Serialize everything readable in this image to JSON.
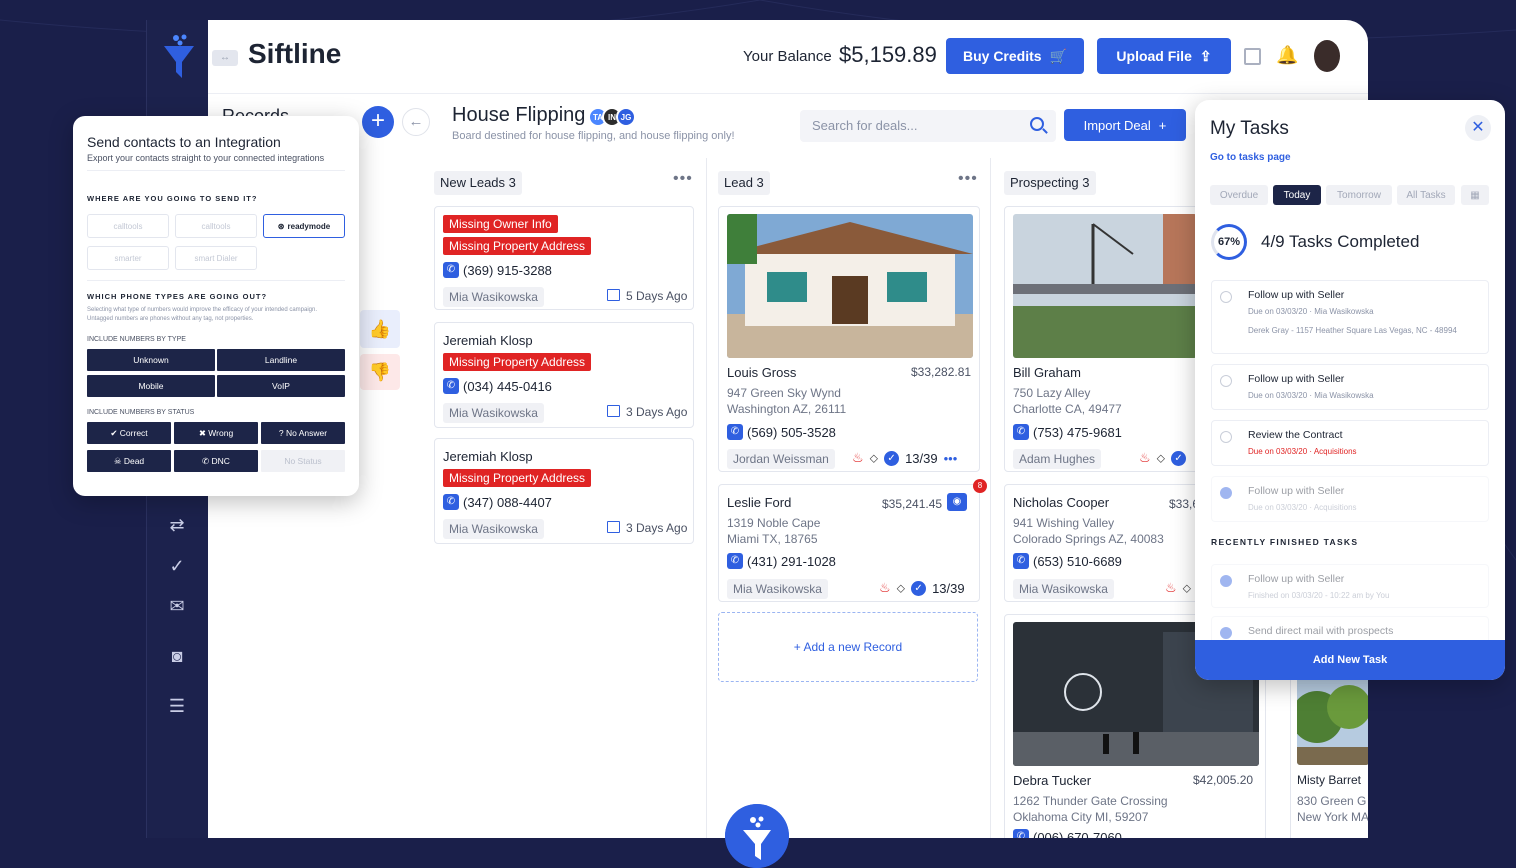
{
  "app": {
    "brand": "Siftline",
    "balance_label": "Your Balance",
    "balance_value": "$5,159.89",
    "buy_credits": "Buy Credits",
    "upload_file": "Upload File"
  },
  "board": {
    "title": "House Flipping",
    "subtitle": "Board destined for house flipping, and house flipping only!",
    "search_placeholder": "Search for deals...",
    "import_deal": "Import Deal",
    "peeking_header": "Records",
    "tags": [
      "TA",
      "IN",
      "JG"
    ]
  },
  "columns": [
    {
      "title": "New Leads",
      "count": "3"
    },
    {
      "title": "Lead",
      "count": "3"
    },
    {
      "title": "Prospecting",
      "count": "3"
    }
  ],
  "new_leads": [
    {
      "flags": [
        "Missing Owner Info",
        "Missing Property Address"
      ],
      "phone": "(369) 915-3288",
      "owner": "Mia Wasikowska",
      "ago": "5 Days Ago"
    },
    {
      "name": "Jeremiah Klosp",
      "flags": [
        "Missing Property Address"
      ],
      "phone": "(034) 445-0416",
      "owner": "Mia Wasikowska",
      "ago": "3 Days Ago"
    },
    {
      "name": "Jeremiah Klosp",
      "flags": [
        "Missing Property Address"
      ],
      "phone": "(347) 088-4407",
      "owner": "Mia Wasikowska",
      "ago": "3 Days Ago"
    }
  ],
  "lead": [
    {
      "name": "Louis Gross",
      "amount": "$33,282.81",
      "addr1": "947 Green Sky Wynd",
      "addr2": "Washington AZ, 26111",
      "phone": "(569) 505-3528",
      "owner": "Jordan Weissman",
      "progress": "13/39"
    },
    {
      "name": "Leslie Ford",
      "amount": "$35,241.45",
      "addr1": "1319 Noble Cape",
      "addr2": "Miami TX, 18765",
      "phone": "(431) 291-1028",
      "owner": "Mia Wasikowska",
      "progress": "13/39",
      "badge": "8"
    }
  ],
  "add_record": "+ Add a new Record",
  "prospecting": [
    {
      "name": "Bill Graham",
      "addr1": "750 Lazy Alley",
      "addr2": "Charlotte CA, 49477",
      "phone": "(753) 475-9681",
      "owner": "Adam Hughes"
    },
    {
      "name": "Nicholas Cooper",
      "amount": "$33,6",
      "addr1": "941 Wishing Valley",
      "addr2": "Colorado Springs AZ, 40083",
      "phone": "(653) 510-6689",
      "owner": "Mia Wasikowska"
    },
    {
      "name": "Debra Tucker",
      "amount": "$42,005.20",
      "addr1": "1262 Thunder Gate Crossing",
      "addr2": "Oklahoma City MI, 59207",
      "phone": "(006) 670-7060"
    }
  ],
  "fourth_col": {
    "name": "Misty Barret",
    "addr1": "830 Green G",
    "addr2": "New York MA"
  },
  "integration": {
    "title": "Send contacts to an Integration",
    "subtitle": "Export your contacts straight to your connected integrations",
    "where_heading": "WHERE ARE YOU GOING TO SEND IT?",
    "integrations": [
      "calltools",
      "calltools",
      "readymode",
      "smarter",
      "smart Dialer"
    ],
    "phone_heading": "WHICH PHONE TYPES ARE GOING OUT?",
    "phone_note": "Selecting what type of numbers would improve the efficacy of your intended campaign. Untagged numbers are phones without any tag, not properties.",
    "by_type": "INCLUDE NUMBERS BY TYPE",
    "types": [
      "Unknown",
      "Landline",
      "Mobile",
      "VoIP"
    ],
    "by_status": "INCLUDE NUMBERS BY STATUS",
    "statuses": [
      "Correct",
      "Wrong",
      "No Answer",
      "Dead",
      "DNC",
      "No Status"
    ]
  },
  "tasks": {
    "title": "My Tasks",
    "link": "Go to tasks page",
    "tabs": [
      "Overdue",
      "Today",
      "Tomorrow",
      "All Tasks"
    ],
    "percent": "67%",
    "completed": "4/9 Tasks Completed",
    "items": [
      {
        "name": "Follow up with Seller",
        "meta": "Due on 03/03/20  ·  Mia Wasikowska",
        "extra": "Derek Gray - 1157 Heather Square Las Vegas, NC - 48994"
      },
      {
        "name": "Follow up with Seller",
        "meta": "Due on 03/03/20  ·  Mia Wasikowska"
      },
      {
        "name": "Review the Contract",
        "meta": "Due on 03/03/20  ·  Acquisitions"
      },
      {
        "name": "Follow up with Seller",
        "meta": "Due on 03/03/20  ·  Acquisitions"
      }
    ],
    "recent_heading": "RECENTLY FINISHED TASKS",
    "recent": [
      {
        "name": "Follow up with Seller",
        "meta": "Finished on 03/03/20 - 10:22 am by You"
      },
      {
        "name": "Send direct mail with prospects"
      }
    ],
    "add": "Add New Task"
  }
}
